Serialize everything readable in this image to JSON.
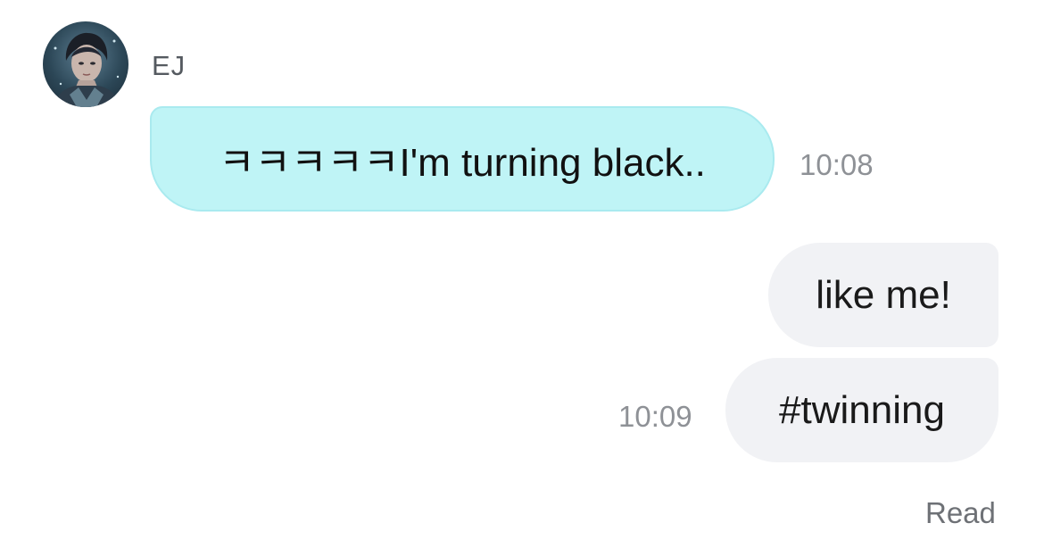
{
  "sender": {
    "name": "EJ",
    "avatar_icon": "profile-photo"
  },
  "messages": [
    {
      "direction": "incoming",
      "text": "ㅋㅋㅋㅋㅋI'm turning black..",
      "time": "10:08"
    },
    {
      "direction": "outgoing",
      "text": "like me!"
    },
    {
      "direction": "outgoing",
      "text": "#twinning",
      "time": "10:09"
    }
  ],
  "status": {
    "read_label": "Read"
  },
  "colors": {
    "incoming_bubble": "#bff4f6",
    "outgoing_bubble": "#f1f2f5",
    "timestamp": "#8e9196"
  }
}
